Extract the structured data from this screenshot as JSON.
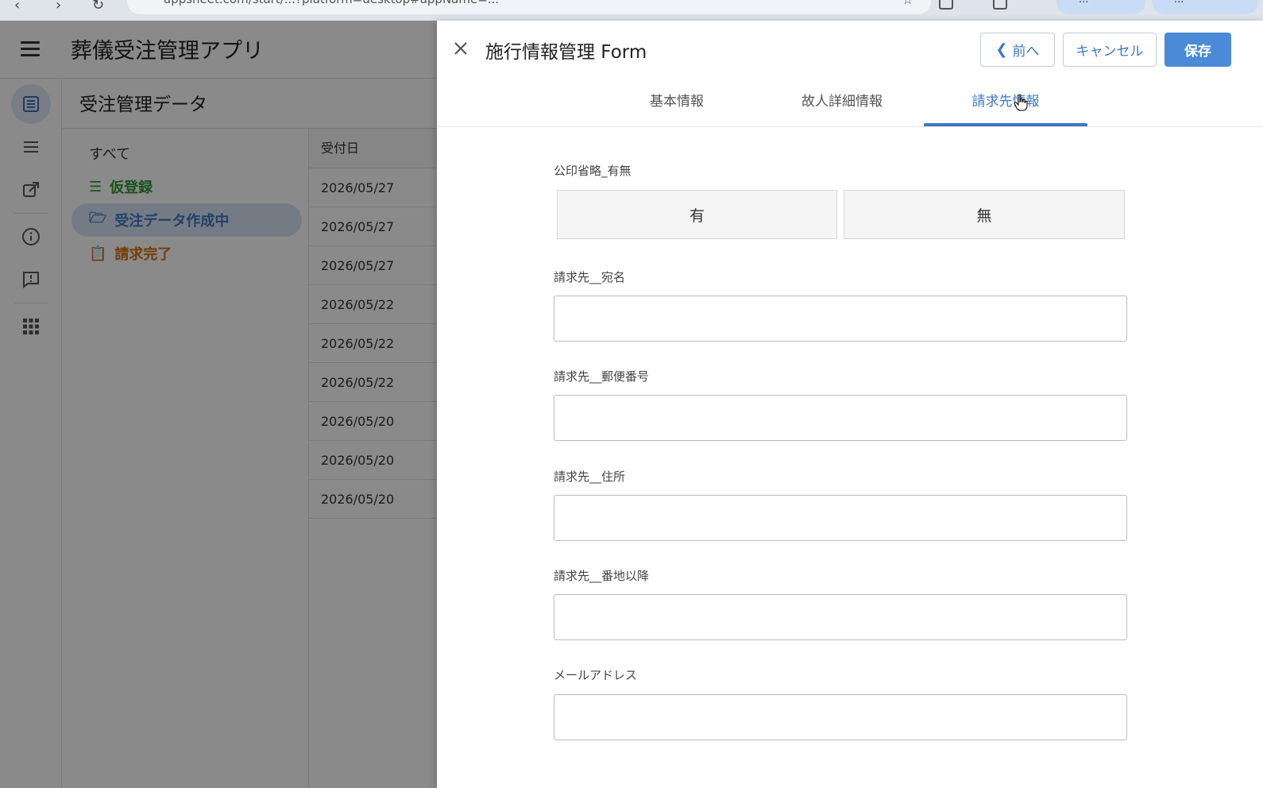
{
  "browser": {
    "url": "appsheet.com/start/...?platform=desktop#appName=...",
    "pill1_label": "...",
    "pill2_label": "..."
  },
  "app": {
    "title": "葬儀受注管理アプリ",
    "view_title": "受注管理データ",
    "filters": [
      {
        "label": "すべて"
      },
      {
        "label": "仮登録"
      },
      {
        "label": "受注データ作成中"
      },
      {
        "label": "請求完了"
      }
    ],
    "table": {
      "header": "受付日",
      "rows": [
        "2026/05/27",
        "2026/05/27",
        "2026/05/27",
        "2026/05/22",
        "2026/05/22",
        "2026/05/22",
        "2026/05/20",
        "2026/05/20",
        "2026/05/20"
      ]
    }
  },
  "form": {
    "title": "施行情報管理 Form",
    "buttons": {
      "prev": "前へ",
      "cancel": "キャンセル",
      "save": "保存"
    },
    "tabs": [
      {
        "label": "基本情報"
      },
      {
        "label": "故人詳細情報"
      },
      {
        "label": "請求先情報"
      }
    ],
    "active_tab": 2,
    "fields": {
      "seal_omit": {
        "label": "公印省略_有無",
        "options": [
          "有",
          "無"
        ]
      },
      "billing_name": {
        "label": "請求先__宛名",
        "value": ""
      },
      "billing_zip": {
        "label": "請求先__郵便番号",
        "value": ""
      },
      "billing_address": {
        "label": "請求先__住所",
        "value": ""
      },
      "billing_street": {
        "label": "請求先__番地以降",
        "value": ""
      },
      "email": {
        "label": "メールアドレス",
        "value": ""
      }
    }
  },
  "colors": {
    "accent": "#3f78c4",
    "save_bg": "#4a8ad6",
    "filter_green": "#2e9a34",
    "filter_orange": "#d4730f"
  }
}
